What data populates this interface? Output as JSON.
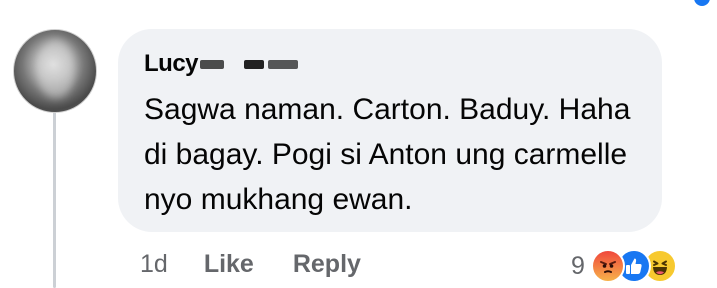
{
  "comment": {
    "author": "Lucy",
    "text": "Sagwa naman. Carton. Baduy. Haha di bagay. Pogi si Anton ung carmelle nyo mukhang ewan."
  },
  "meta": {
    "time": "1d",
    "like_label": "Like",
    "reply_label": "Reply"
  },
  "reactions": {
    "count": "9",
    "icons": [
      "angry-icon",
      "like-icon",
      "haha-icon"
    ]
  },
  "colors": {
    "bubble_bg": "#f0f2f5",
    "meta_text": "#65676b",
    "like_blue": "#1877f2"
  }
}
